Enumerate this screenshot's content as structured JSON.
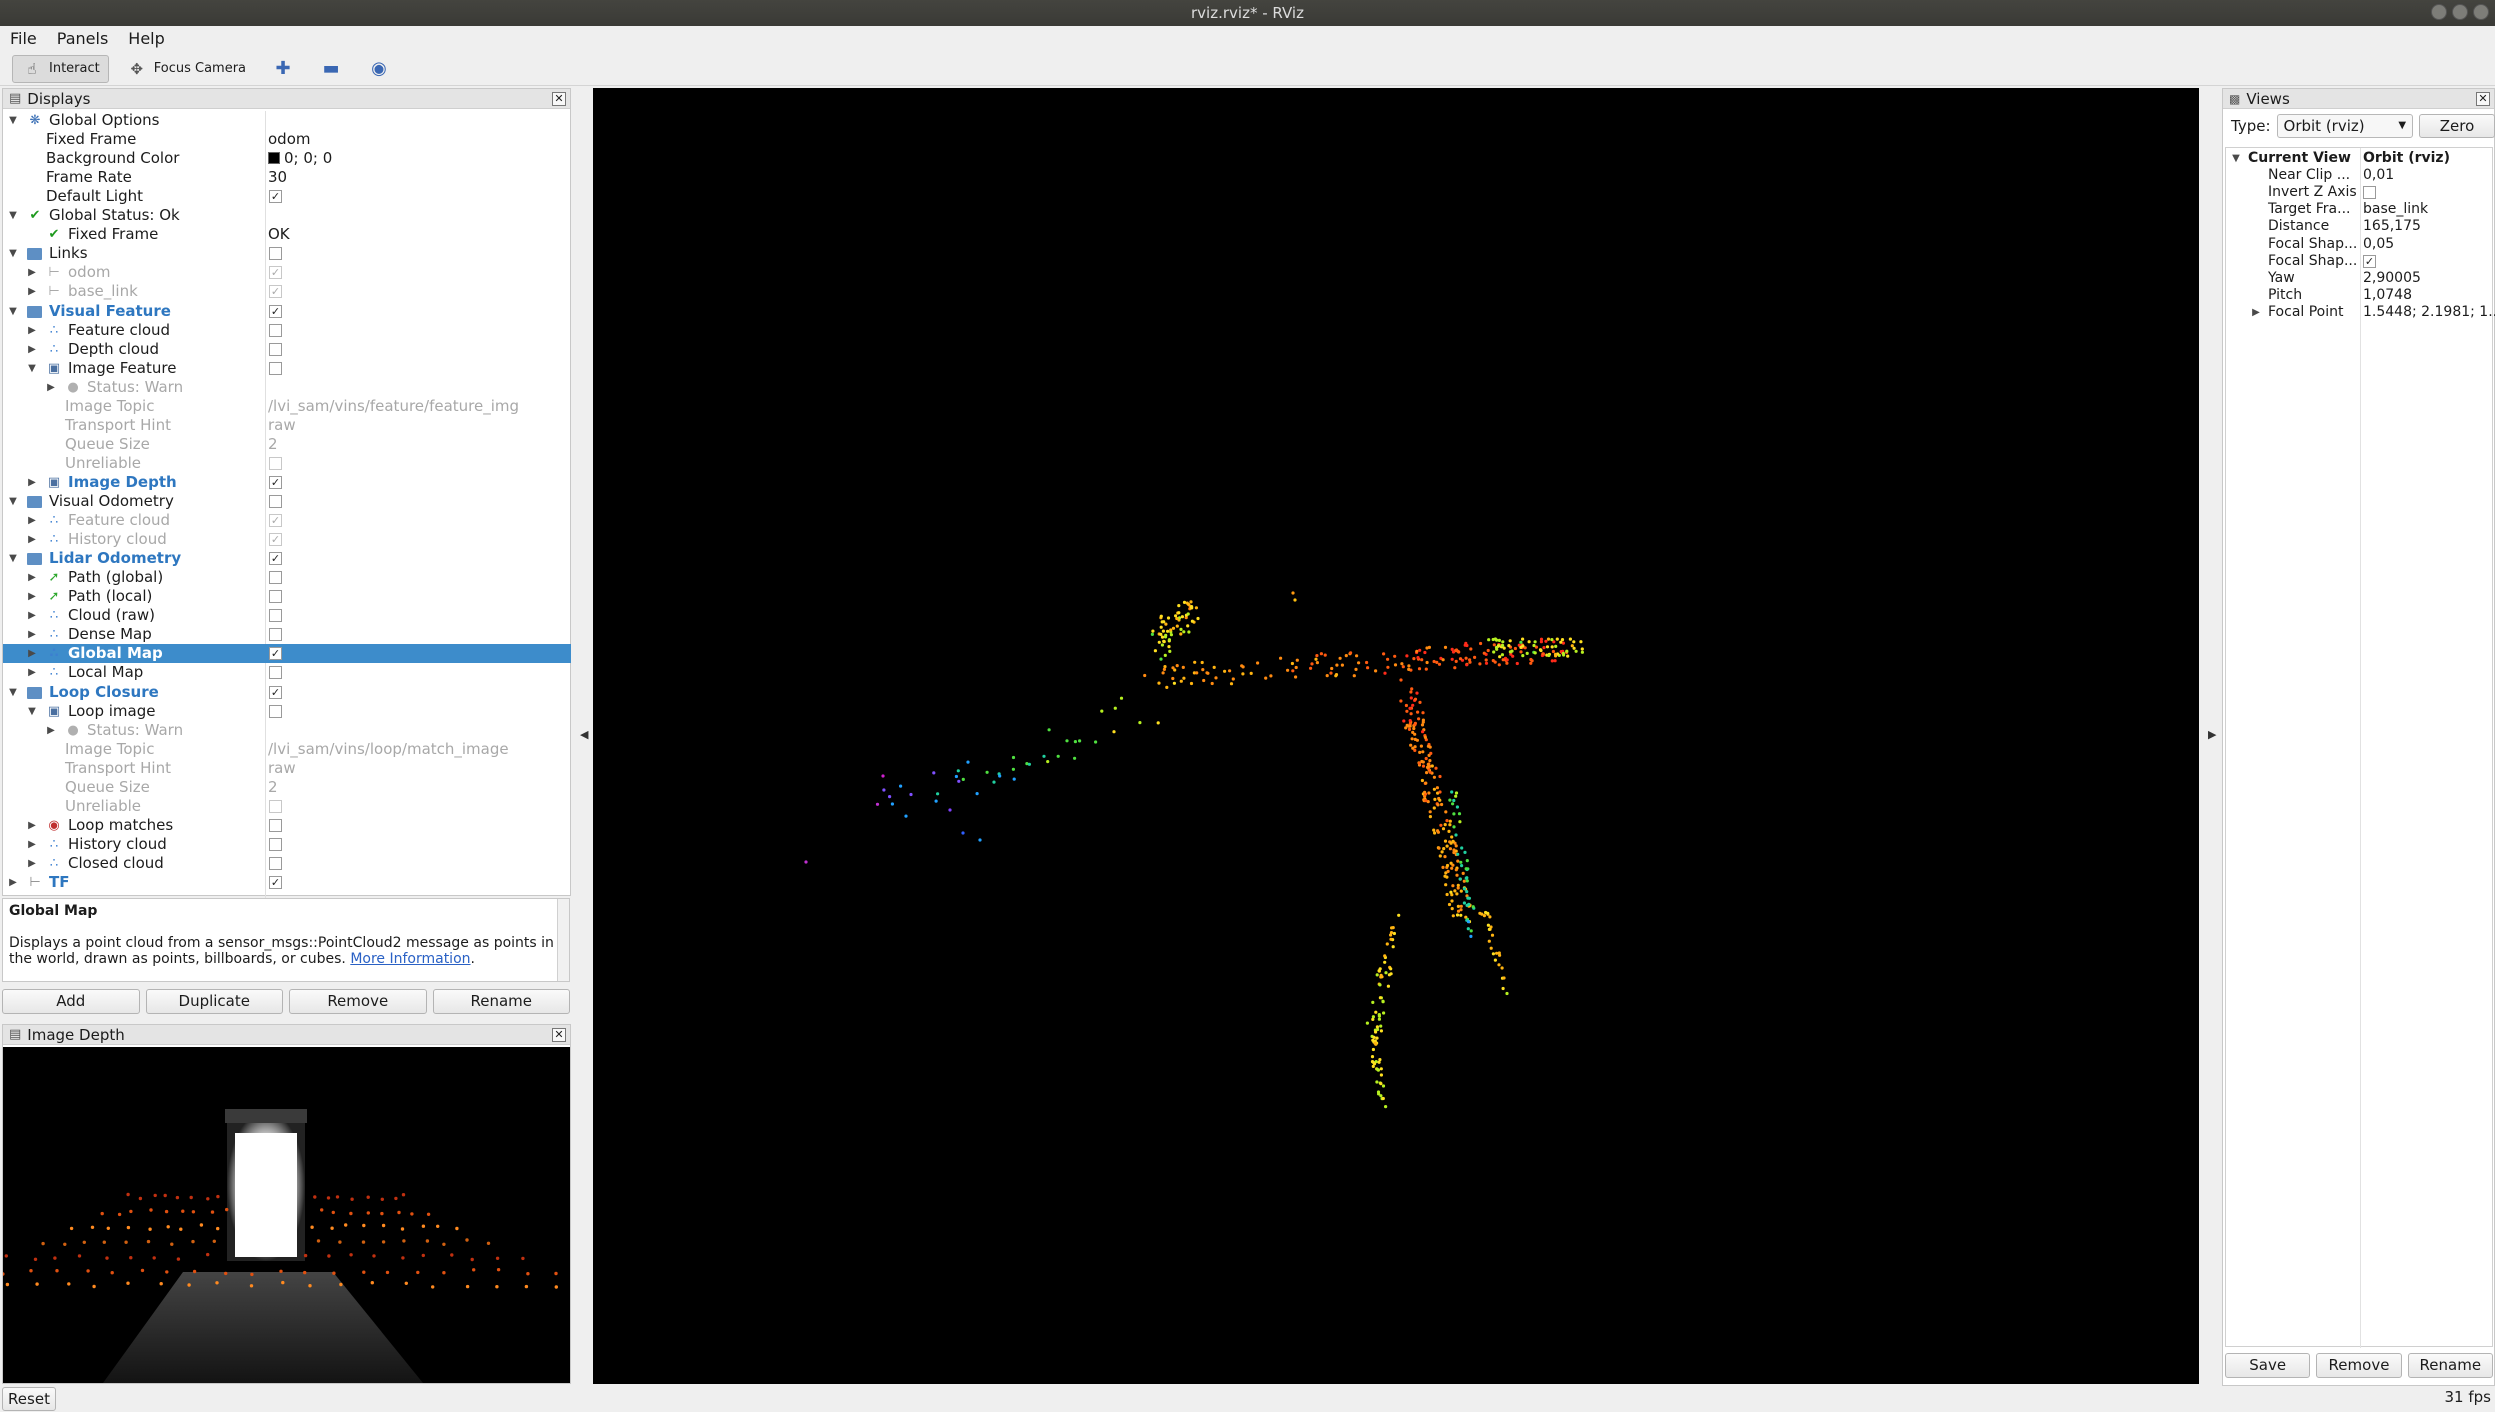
{
  "window": {
    "title": "rviz.rviz* - RViz"
  },
  "menu": {
    "file": "File",
    "panels": "Panels",
    "help": "Help"
  },
  "toolbar": {
    "interact": "Interact",
    "focus_camera": "Focus Camera"
  },
  "displays": {
    "title": "Displays",
    "rows": [
      {
        "label": "Global Options",
        "value": ""
      },
      {
        "label": "Fixed Frame",
        "value": "odom"
      },
      {
        "label": "Background Color",
        "value": "0; 0; 0"
      },
      {
        "label": "Frame Rate",
        "value": "30"
      },
      {
        "label": "Default Light",
        "value": ""
      },
      {
        "label": "Global Status: Ok",
        "value": ""
      },
      {
        "label": "Fixed Frame",
        "value": "OK"
      },
      {
        "label": "Links",
        "value": ""
      },
      {
        "label": "odom",
        "value": ""
      },
      {
        "label": "base_link",
        "value": ""
      },
      {
        "label": "Visual Feature",
        "value": ""
      },
      {
        "label": "Feature cloud",
        "value": ""
      },
      {
        "label": "Depth cloud",
        "value": ""
      },
      {
        "label": "Image Feature",
        "value": ""
      },
      {
        "label": "Status: Warn",
        "value": ""
      },
      {
        "label": "Image Topic",
        "value": "/lvi_sam/vins/feature/feature_img"
      },
      {
        "label": "Transport Hint",
        "value": "raw"
      },
      {
        "label": "Queue Size",
        "value": "2"
      },
      {
        "label": "Unreliable",
        "value": ""
      },
      {
        "label": "Image Depth",
        "value": ""
      },
      {
        "label": "Visual Odometry",
        "value": ""
      },
      {
        "label": "Feature cloud",
        "value": ""
      },
      {
        "label": "History cloud",
        "value": ""
      },
      {
        "label": "Lidar Odometry",
        "value": ""
      },
      {
        "label": "Path (global)",
        "value": ""
      },
      {
        "label": "Path (local)",
        "value": ""
      },
      {
        "label": "Cloud (raw)",
        "value": ""
      },
      {
        "label": "Dense Map",
        "value": ""
      },
      {
        "label": "Global Map",
        "value": ""
      },
      {
        "label": "Local Map",
        "value": ""
      },
      {
        "label": "Loop Closure",
        "value": ""
      },
      {
        "label": "Loop image",
        "value": ""
      },
      {
        "label": "Status: Warn",
        "value": ""
      },
      {
        "label": "Image Topic",
        "value": "/lvi_sam/vins/loop/match_image"
      },
      {
        "label": "Transport Hint",
        "value": "raw"
      },
      {
        "label": "Queue Size",
        "value": "2"
      },
      {
        "label": "Unreliable",
        "value": ""
      },
      {
        "label": "Loop matches",
        "value": ""
      },
      {
        "label": "History cloud",
        "value": ""
      },
      {
        "label": "Closed cloud",
        "value": ""
      },
      {
        "label": "TF",
        "value": ""
      }
    ]
  },
  "description": {
    "title": "Global Map",
    "text": "Displays a point cloud from a sensor_msgs::PointCloud2 message as points in the world, drawn as points, billboards, or cubes.",
    "link": "More Information",
    "period": "."
  },
  "display_buttons": {
    "add": "Add",
    "duplicate": "Duplicate",
    "remove": "Remove",
    "rename": "Rename"
  },
  "image_depth_panel": {
    "title": "Image Depth"
  },
  "views": {
    "title": "Views",
    "type_label": "Type:",
    "type_value": "Orbit (rviz)",
    "zero": "Zero",
    "rows": [
      {
        "label": "Current View",
        "value": "Orbit (rviz)"
      },
      {
        "label": "Near Clip ...",
        "value": "0,01"
      },
      {
        "label": "Invert Z Axis",
        "value": ""
      },
      {
        "label": "Target Fra...",
        "value": "base_link"
      },
      {
        "label": "Distance",
        "value": "165,175"
      },
      {
        "label": "Focal Shap...",
        "value": "0,05"
      },
      {
        "label": "Focal Shap...",
        "value": ""
      },
      {
        "label": "Yaw",
        "value": "2,90005"
      },
      {
        "label": "Pitch",
        "value": "1,0748"
      },
      {
        "label": "Focal Point",
        "value": "1.5448; 2.1981; 1..."
      }
    ],
    "save": "Save",
    "remove": "Remove",
    "rename": "Rename"
  },
  "status": {
    "reset": "Reset",
    "fps": "31 fps"
  },
  "colors": {
    "selection": "#3d8ccb",
    "accent_blue": "#2e77c0",
    "viewport_bg": "#000000"
  }
}
